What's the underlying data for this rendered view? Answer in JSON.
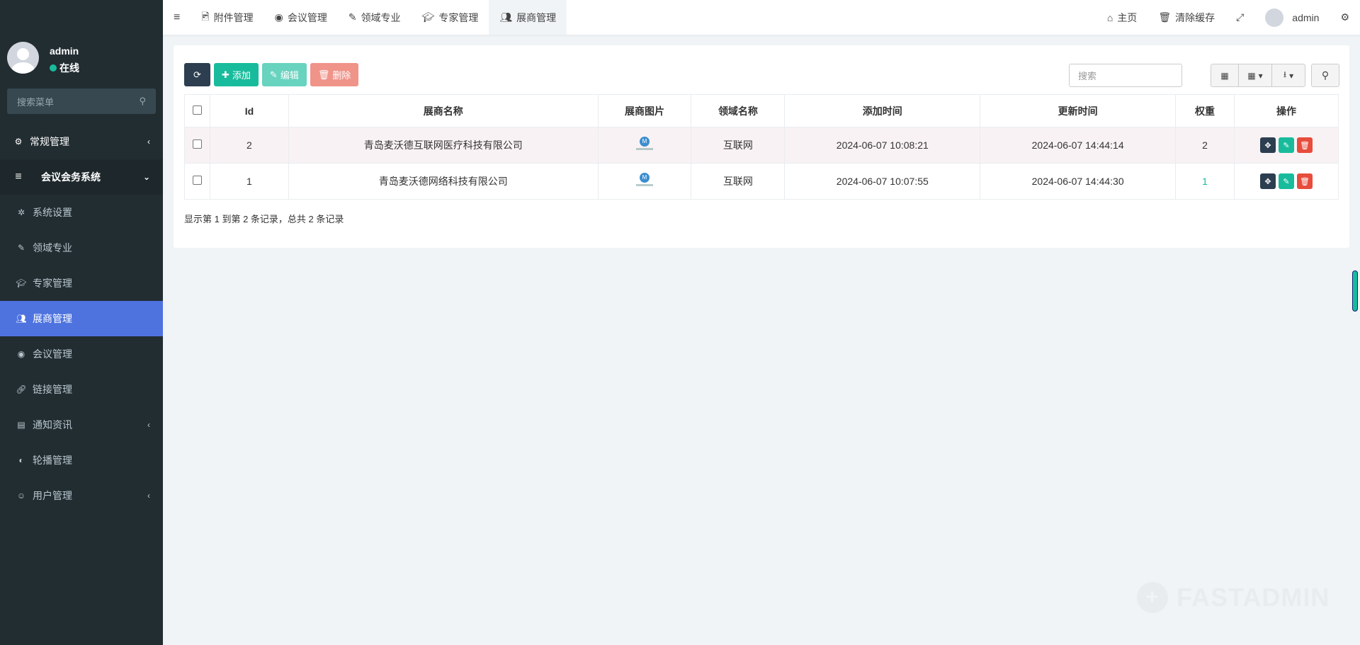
{
  "user": {
    "name": "admin",
    "status": "在线"
  },
  "sidebar": {
    "search_placeholder": "搜索菜单",
    "items": [
      {
        "label": "常规管理",
        "icon": "cogs-icon"
      },
      {
        "label": "会议会务系统",
        "icon": "bars-icon"
      },
      {
        "label": "系统设置",
        "icon": "gear-icon"
      },
      {
        "label": "领域专业",
        "icon": "pencil-icon"
      },
      {
        "label": "专家管理",
        "icon": "graduation-cap-icon"
      },
      {
        "label": "展商管理",
        "icon": "users-icon"
      },
      {
        "label": "会议管理",
        "icon": "chrome-icon"
      },
      {
        "label": "链接管理",
        "icon": "link-icon"
      },
      {
        "label": "通知资讯",
        "icon": "newspaper-icon"
      },
      {
        "label": "轮播管理",
        "icon": "compass-icon"
      },
      {
        "label": "用户管理",
        "icon": "user-circle-icon"
      }
    ]
  },
  "header": {
    "tabs": [
      {
        "label": "附件管理"
      },
      {
        "label": "会议管理"
      },
      {
        "label": "领域专业"
      },
      {
        "label": "专家管理"
      },
      {
        "label": "展商管理"
      }
    ],
    "home": "主页",
    "clear_cache": "清除缓存",
    "admin": "admin"
  },
  "toolbar": {
    "add": "添加",
    "edit": "编辑",
    "delete": "删除",
    "search_placeholder": "搜索"
  },
  "table": {
    "headers": [
      "Id",
      "展商名称",
      "展商图片",
      "领域名称",
      "添加时间",
      "更新时间",
      "权重",
      "操作"
    ],
    "rows": [
      {
        "id": "2",
        "name": "青岛麦沃德互联网医疗科技有限公司",
        "field": "互联网",
        "created": "2024-06-07 10:08:21",
        "updated": "2024-06-07 14:44:14",
        "weight": "2"
      },
      {
        "id": "1",
        "name": "青岛麦沃德网络科技有限公司",
        "field": "互联网",
        "created": "2024-06-07 10:07:55",
        "updated": "2024-06-07 14:44:30",
        "weight": "1"
      }
    ]
  },
  "pager": {
    "summary": "显示第 1 到第 2 条记录，总共 2 条记录"
  },
  "watermark": {
    "brand": "FASTADMIN"
  }
}
